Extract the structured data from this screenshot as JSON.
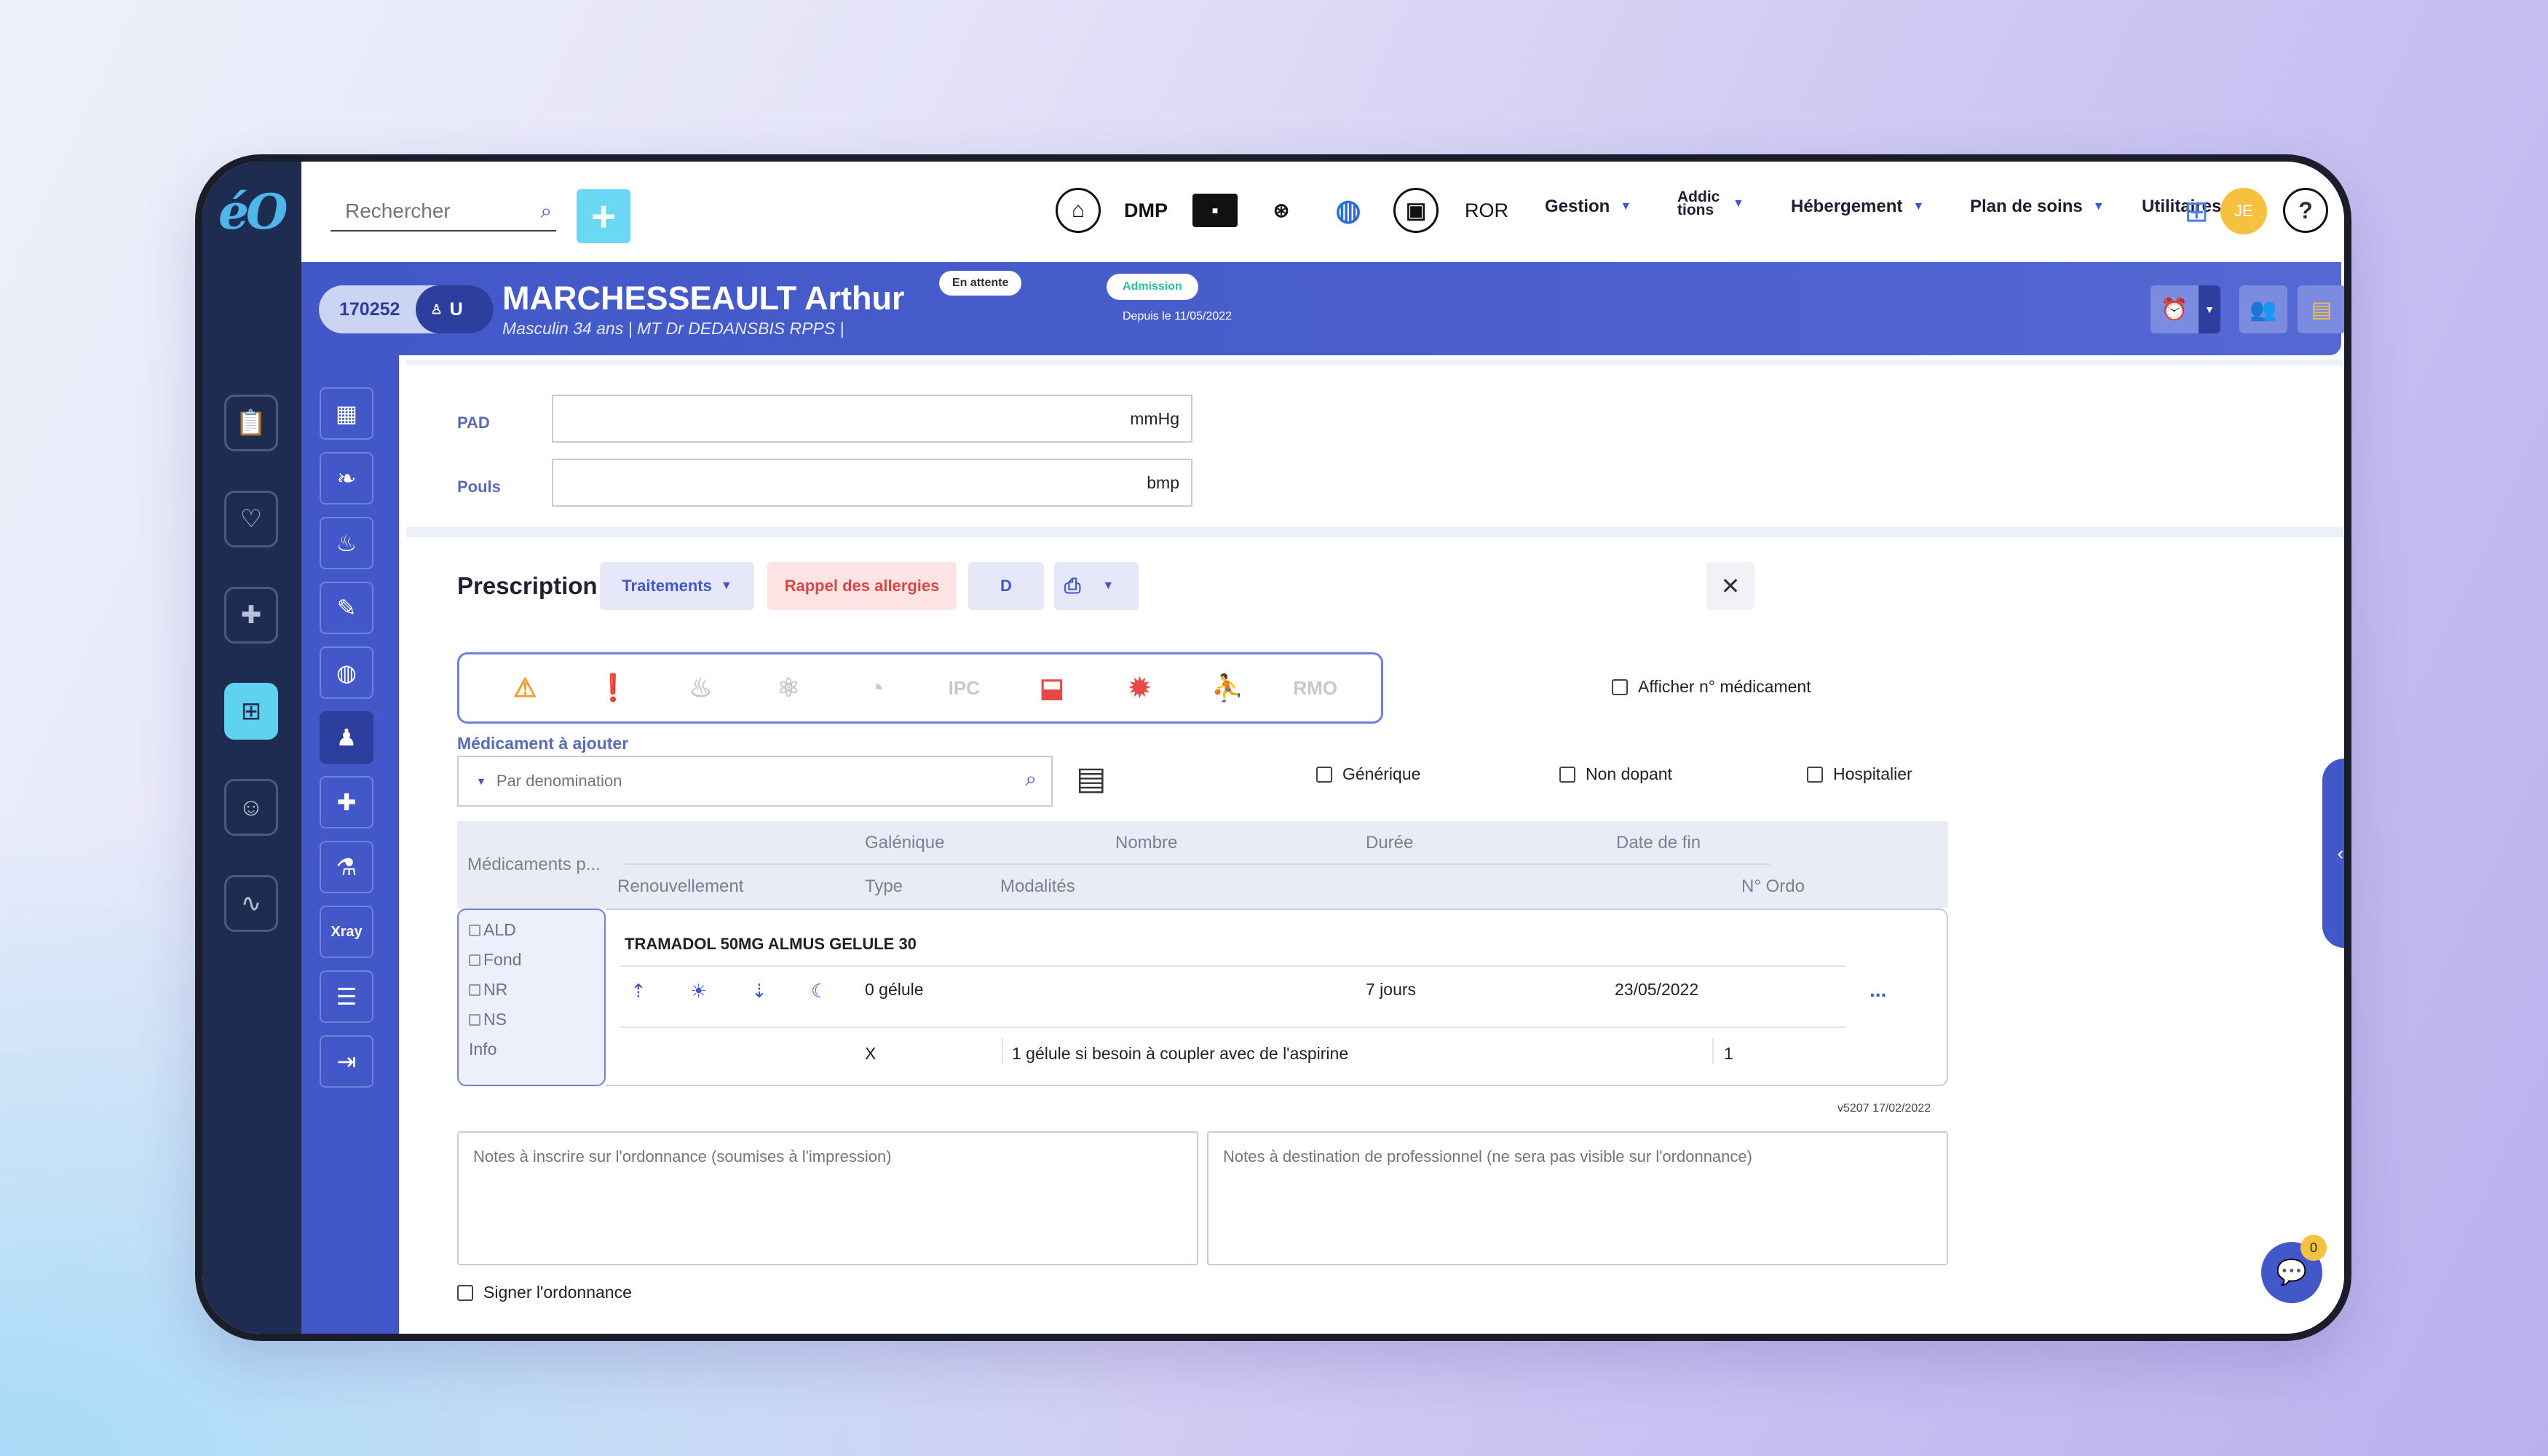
{
  "app": {
    "logo": "éO"
  },
  "search": {
    "placeholder": "Rechercher",
    "add_label": "+"
  },
  "topbar": {
    "dmp_label": "DMP",
    "ror_label": "ROR",
    "menus": [
      {
        "label": "Gestion"
      },
      {
        "label": "Addictions"
      },
      {
        "label": "Hébergement"
      },
      {
        "label": "Plan de soins"
      },
      {
        "label": "Utilitaires"
      }
    ],
    "avatar_initials": "JE",
    "help_label": "?"
  },
  "patient": {
    "id": "170252",
    "tag": "U",
    "name": "MARCHESSEAULT Arthur",
    "subtitle": "Masculin 34 ans | MT Dr DEDANSBIS RPPS |",
    "status_badge": "En attente",
    "admission_badge": "Admission",
    "since": "Depuis le 11/05/2022"
  },
  "vitals": [
    {
      "label": "PAD",
      "unit": "mmHg"
    },
    {
      "label": "Pouls",
      "unit": "bmp"
    }
  ],
  "prescription": {
    "title": "Prescription",
    "traitements_label": "Traitements",
    "allergies_label": "Rappel des allergies",
    "d_label": "D",
    "icon_labels": {
      "ipc": "IPC",
      "rmo": "RMO"
    },
    "afficher_label": "Afficher n° médicament",
    "med_label": "Médicament à ajouter",
    "med_placeholder": "Par denomination",
    "checks": [
      {
        "label": "Générique"
      },
      {
        "label": "Non dopant"
      },
      {
        "label": "Hospitalier"
      }
    ],
    "headers": {
      "medicaments": "Médicaments p...",
      "galenique": "Galénique",
      "nombre": "Nombre",
      "duree": "Durée",
      "date_fin": "Date de fin",
      "renouvellement": "Renouvellement",
      "type": "Type",
      "modalites": "Modalités",
      "no_ordo": "N° Ordo"
    },
    "side_options": [
      "ALD",
      "Fond",
      "NR",
      "NS"
    ],
    "side_info": "Info",
    "drug": {
      "name": "TRAMADOL 50MG ALMUS GELULE 30",
      "dose": "0 gélule",
      "duration": "7 jours",
      "end_date": "23/05/2022",
      "type": "X",
      "modalities": "1 gélule si besoin à coupler avec de l'aspirine",
      "ordo": "1",
      "more": "..."
    },
    "version": "v5207 17/02/2022",
    "notes_ordonnance_placeholder": "Notes à inscrire sur l'ordonnance (soumises à l'impression)",
    "notes_pro_placeholder": "Notes à destination de professionnel (ne sera pas visible sur l'ordonnance)",
    "sign_label": "Signer l'ordonnance"
  },
  "right_tools": {
    "more_label": "..."
  },
  "chat": {
    "count": "0"
  },
  "colors": {
    "primary": "#4258c8",
    "accent": "#69d8f3",
    "rail": "#1f2c52",
    "allergy_bg": "#fde3e3",
    "allergy_text": "#d84848",
    "avatar": "#f5c13f"
  }
}
